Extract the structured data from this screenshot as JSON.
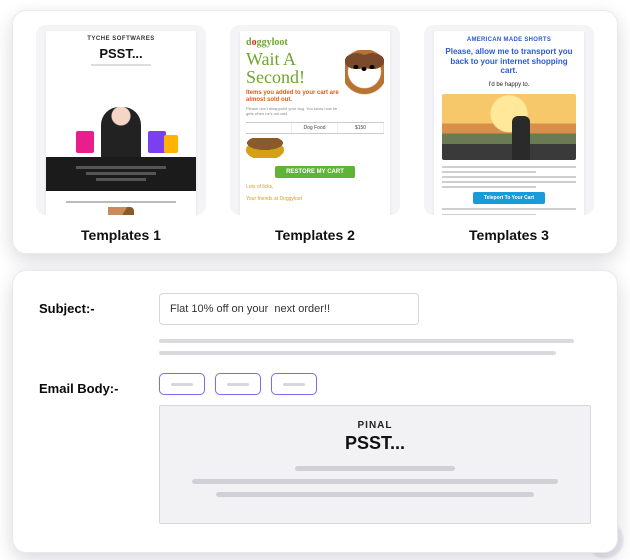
{
  "templates": {
    "items": [
      {
        "caption": "Templates 1"
      },
      {
        "caption": "Templates 2"
      },
      {
        "caption": "Templates 3"
      }
    ],
    "preview1": {
      "brand": "TYCHE SOFTWARES",
      "headline": "PSST..."
    },
    "preview2": {
      "logo_prefix": "d",
      "logo_oo": "o",
      "logo_rest": "ggyloot",
      "wait": "Wait A Second!",
      "red_text": "Items you added to your cart are almost sold out.",
      "tiny_text": "Please don't disappoint your dog. You know how he gets when he's not well.",
      "col_item": "Dog Food",
      "col_price": "$150",
      "restore": "RESTORE MY CART",
      "sig1": "Lots of licks,",
      "sig2": "Your friends at Doggyloot"
    },
    "preview3": {
      "brand": "AMERICAN MADE SHORTS",
      "headline": "Please, allow me to transport you back to your internet shopping cart.",
      "sub": "I'd be happy to.",
      "cta": "Teleport To Your Cart"
    }
  },
  "editor": {
    "subject_label": "Subject:-",
    "subject_value": "Flat 10% off on your  next order!!",
    "body_label": "Email Body:-",
    "canvas": {
      "brand": "PINAL",
      "headline": "PSST..."
    }
  }
}
